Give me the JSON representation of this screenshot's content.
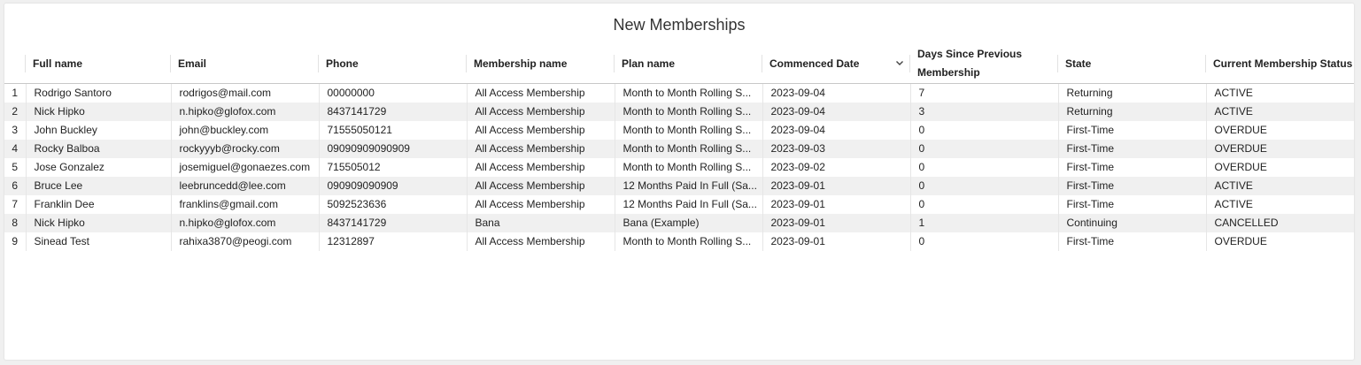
{
  "title": "New Memberships",
  "icons": {
    "sort": "chevron-down-icon"
  },
  "columns": [
    "Full name",
    "Email",
    "Phone",
    "Membership name",
    "Plan name",
    "Commenced Date",
    "Days Since Previous Membership",
    "State",
    "Current Membership Status"
  ],
  "rows": [
    {
      "n": "1",
      "name": "Rodrigo Santoro",
      "email": "rodrigos@mail.com",
      "phone": "00000000",
      "membership": "All Access Membership",
      "plan": "Month to Month Rolling S...",
      "date": "2023-09-04",
      "days": "7",
      "state": "Returning",
      "status": "ACTIVE"
    },
    {
      "n": "2",
      "name": "Nick Hipko",
      "email": "n.hipko@glofox.com",
      "phone": "8437141729",
      "membership": "All Access Membership",
      "plan": "Month to Month Rolling S...",
      "date": "2023-09-04",
      "days": "3",
      "state": "Returning",
      "status": "ACTIVE"
    },
    {
      "n": "3",
      "name": "John Buckley",
      "email": "john@buckley.com",
      "phone": "71555050121",
      "membership": "All Access Membership",
      "plan": "Month to Month Rolling S...",
      "date": "2023-09-04",
      "days": "0",
      "state": "First-Time",
      "status": "OVERDUE"
    },
    {
      "n": "4",
      "name": "Rocky Balboa",
      "email": "rockyyyb@rocky.com",
      "phone": "09090909090909",
      "membership": "All Access Membership",
      "plan": "Month to Month Rolling S...",
      "date": "2023-09-03",
      "days": "0",
      "state": "First-Time",
      "status": "OVERDUE"
    },
    {
      "n": "5",
      "name": "Jose Gonzalez",
      "email": "josemiguel@gonaezes.com",
      "phone": "715505012",
      "membership": "All Access Membership",
      "plan": "Month to Month Rolling S...",
      "date": "2023-09-02",
      "days": "0",
      "state": "First-Time",
      "status": "OVERDUE"
    },
    {
      "n": "6",
      "name": "Bruce Lee",
      "email": "leebruncedd@lee.com",
      "phone": "090909090909",
      "membership": "All Access Membership",
      "plan": "12 Months Paid In Full (Sa...",
      "date": "2023-09-01",
      "days": "0",
      "state": "First-Time",
      "status": "ACTIVE"
    },
    {
      "n": "7",
      "name": "Franklin Dee",
      "email": "franklins@gmail.com",
      "phone": "5092523636",
      "membership": "All Access Membership",
      "plan": "12 Months Paid In Full (Sa...",
      "date": "2023-09-01",
      "days": "0",
      "state": "First-Time",
      "status": "ACTIVE"
    },
    {
      "n": "8",
      "name": "Nick Hipko",
      "email": "n.hipko@glofox.com",
      "phone": "8437141729",
      "membership": "Bana",
      "plan": "Bana (Example)",
      "date": "2023-09-01",
      "days": "1",
      "state": "Continuing",
      "status": "CANCELLED"
    },
    {
      "n": "9",
      "name": "Sinead Test",
      "email": "rahixa3870@peogi.com",
      "phone": "12312897",
      "membership": "All Access Membership",
      "plan": "Month to Month Rolling S...",
      "date": "2023-09-01",
      "days": "0",
      "state": "First-Time",
      "status": "OVERDUE"
    }
  ]
}
